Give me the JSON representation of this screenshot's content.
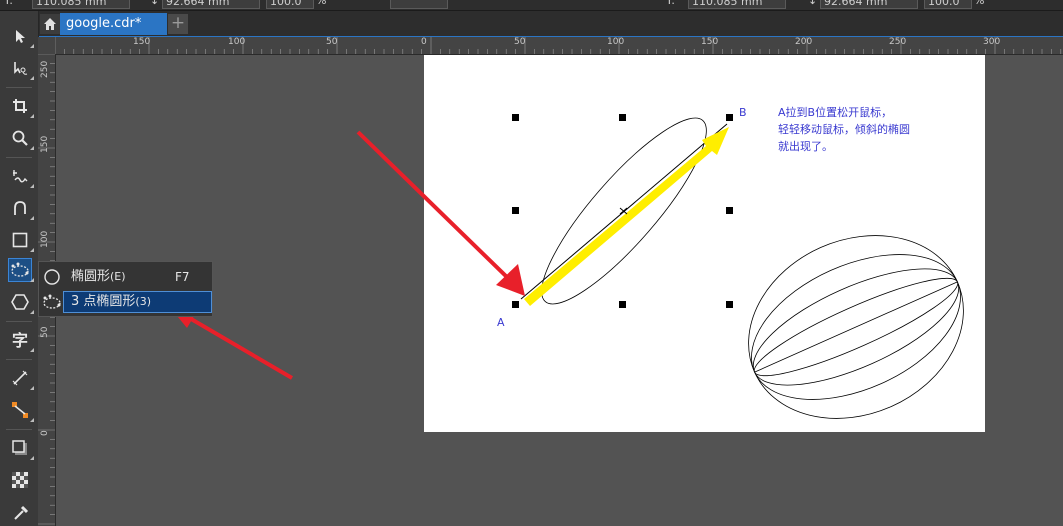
{
  "property_bar": {
    "x_value": "110.085 mm",
    "y_value": "92.664 mm",
    "scale_value": "100.0",
    "percent": "%",
    "x_value_2": "110.085 mm",
    "y_value_2": "92.664 mm",
    "scale_value_2": "100.0",
    "percent_2": "%"
  },
  "tabs": {
    "document_tab": "google.cdr*",
    "new_tab_symbol": "+"
  },
  "rulers": {
    "horizontal_labels": [
      "150",
      "100",
      "50",
      "0",
      "50",
      "100",
      "150",
      "200",
      "250",
      "300"
    ],
    "vertical_labels": [
      "250",
      "150",
      "100",
      "50",
      "0"
    ]
  },
  "flyout": {
    "items": [
      {
        "label": "椭圆形",
        "hotkey": "(E)",
        "shortcut": "F7"
      },
      {
        "label": "3 点椭圆形",
        "hotkey": "(3)",
        "shortcut": ""
      }
    ]
  },
  "canvas": {
    "label_a": "A",
    "label_b": "B",
    "annotation_lines": [
      "A拉到B位置松开鼠标，",
      "轻轻移动鼠标，倾斜的椭圆",
      "就出现了。"
    ]
  },
  "colors": {
    "accent": "#2b75c4",
    "annotation_text": "#3a3ad0",
    "arrow_red": "#e8202a",
    "arrow_yellow": "#ffee00",
    "selected_item": "#0d3b75"
  }
}
